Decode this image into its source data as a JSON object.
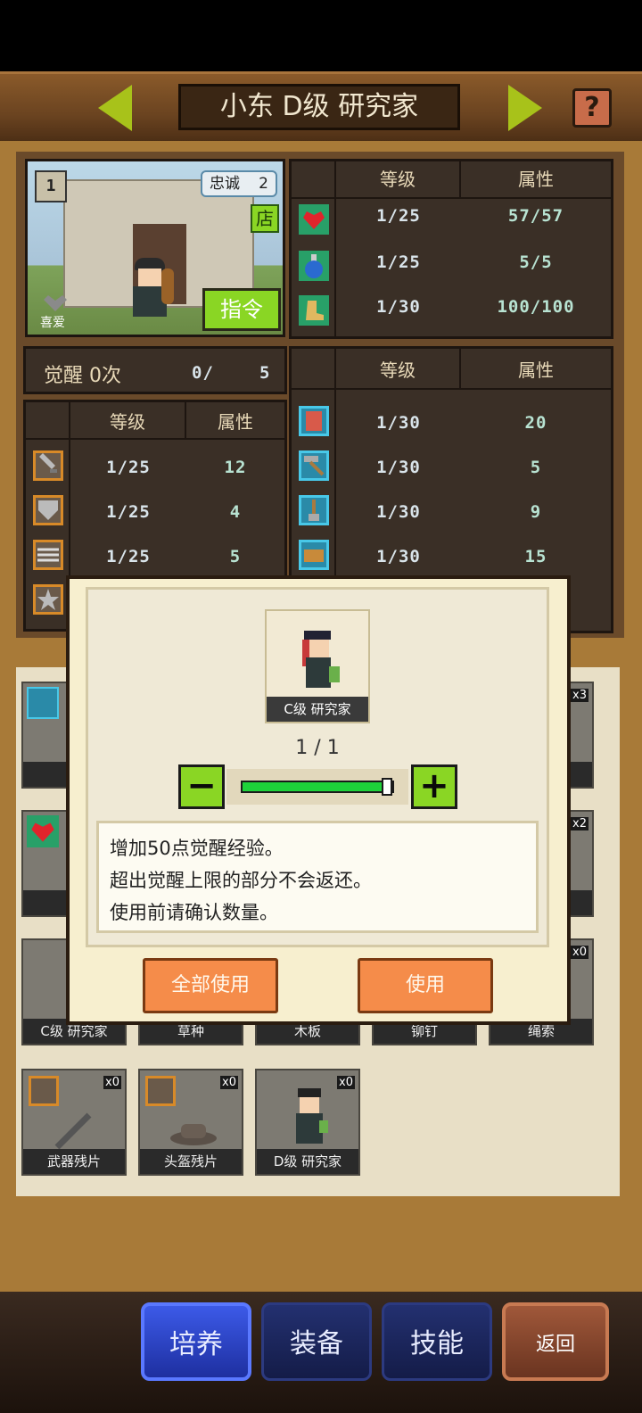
{
  "header": {
    "title": "小东 D级 研究家",
    "help": "?"
  },
  "portrait": {
    "loyalty_label": "忠诚",
    "loyalty_value": "2",
    "shop_badge": "店",
    "command_button": "指令",
    "favorite_label": "喜爱",
    "rank_badge": "1"
  },
  "stats_top": {
    "header_level": "等级",
    "header_attr": "属性",
    "rows": [
      {
        "icon": "heart-icon",
        "level": "1/25",
        "attr": "57/57"
      },
      {
        "icon": "potion-icon",
        "level": "1/25",
        "attr": "5/5"
      },
      {
        "icon": "boot-icon",
        "level": "1/30",
        "attr": "100/100"
      }
    ]
  },
  "awaken": {
    "label": "觉醒 0次",
    "current": "0/",
    "max": "5"
  },
  "stats_left": {
    "header_level": "等级",
    "header_attr": "属性",
    "rows": [
      {
        "icon": "sword-icon",
        "level": "1/25",
        "attr": "12"
      },
      {
        "icon": "shield-icon",
        "level": "1/25",
        "attr": "4"
      },
      {
        "icon": "arrows-icon",
        "level": "1/25",
        "attr": "5"
      }
    ]
  },
  "stats_right": {
    "header_level": "等级",
    "header_attr": "属性",
    "rows": [
      {
        "icon": "book-icon",
        "level": "1/30",
        "attr": "20"
      },
      {
        "icon": "hammer-icon",
        "level": "1/30",
        "attr": "5"
      },
      {
        "icon": "shovel-icon",
        "level": "1/30",
        "attr": "9"
      },
      {
        "icon": "chest-icon",
        "level": "1/30",
        "attr": "15"
      }
    ]
  },
  "inventory": {
    "row3": [
      {
        "label": "C级 研究家"
      },
      {
        "label": "草种"
      },
      {
        "label": "木板"
      },
      {
        "label": "铆钉"
      },
      {
        "label": "绳索"
      }
    ],
    "row4": [
      {
        "label": "武器残片",
        "count": "x0"
      },
      {
        "label": "头盔残片",
        "count": "x0"
      },
      {
        "label": "D级 研究家",
        "count": "x0"
      }
    ],
    "row1_counts": [
      "x3"
    ],
    "row2_counts": [
      "x2"
    ],
    "row3_counts": [
      "x0"
    ]
  },
  "modal": {
    "item_label": "C级 研究家",
    "quantity": "1 / 1",
    "quantity_fraction": 1.0,
    "minus": "−",
    "plus": "+",
    "description": [
      "增加50点觉醒经验。",
      "超出觉醒上限的部分不会返还。",
      "使用前请确认数量。"
    ],
    "use_all_button": "全部使用",
    "use_button": "使用"
  },
  "footer": {
    "tabs": [
      "培养",
      "装备",
      "技能"
    ],
    "back": "返回"
  },
  "colors": {
    "accent_green": "#8ad624",
    "orange": "#f58c4a",
    "blue_active": "#2c44c8"
  }
}
